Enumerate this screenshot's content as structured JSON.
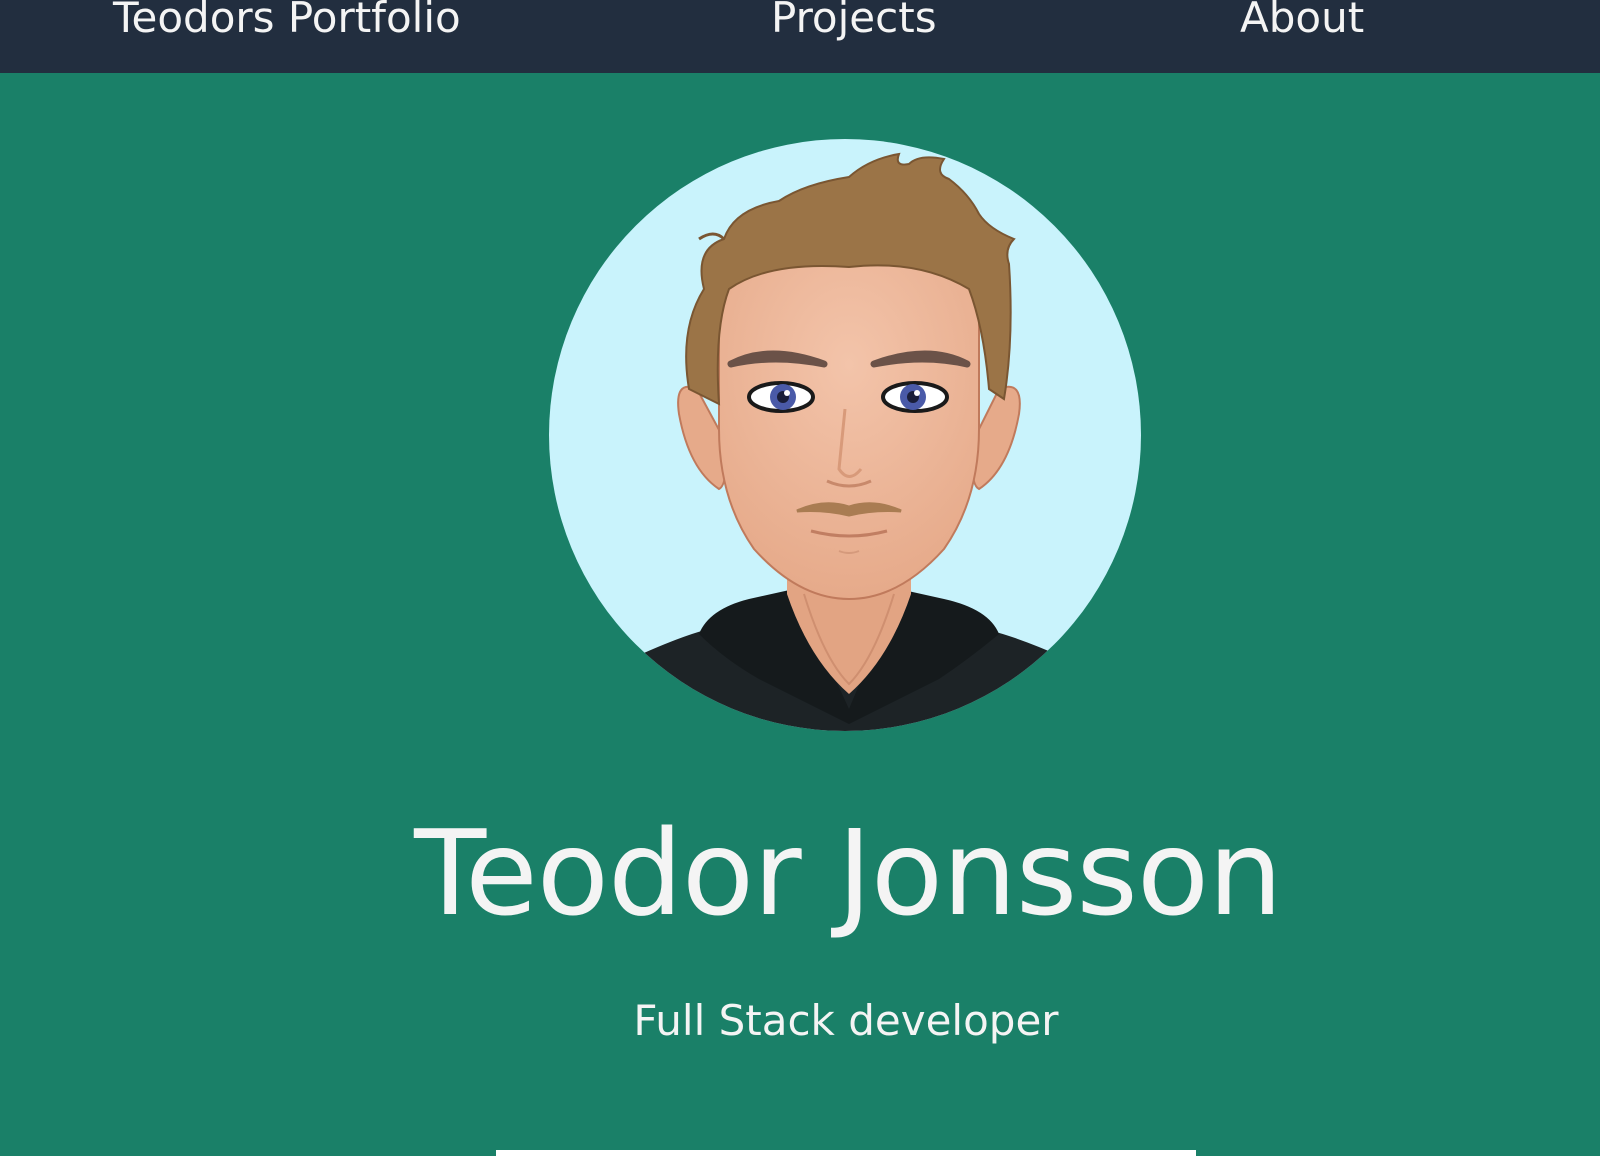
{
  "nav": {
    "brand": "Teodors Portfolio",
    "projects": "Projects",
    "about": "About"
  },
  "hero": {
    "name": "Teodor Jonsson",
    "role": "Full Stack developer"
  },
  "colors": {
    "navbar": "#222e3f",
    "background": "#1a8068",
    "text": "#f4f4f4",
    "avatar_bg": "#c9f3fc"
  }
}
